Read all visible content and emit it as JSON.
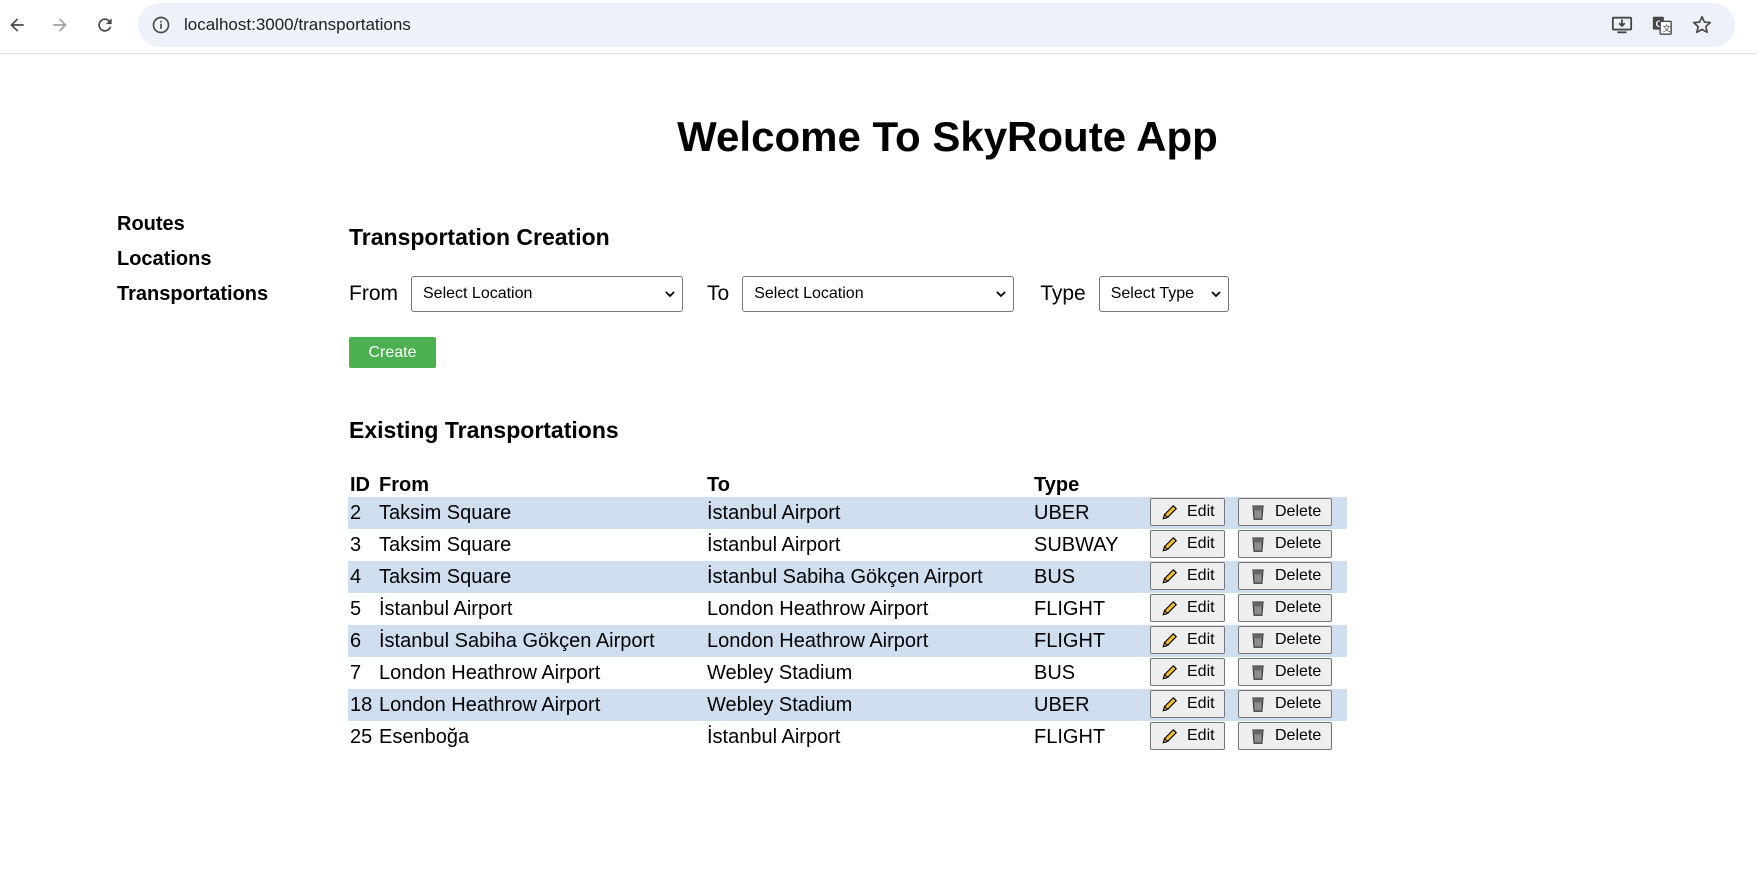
{
  "browser": {
    "url": "localhost:3000/transportations"
  },
  "page": {
    "title": "Welcome To SkyRoute App"
  },
  "sidebar": {
    "items": [
      {
        "label": "Routes"
      },
      {
        "label": "Locations"
      },
      {
        "label": "Transportations"
      }
    ]
  },
  "creation": {
    "title": "Transportation Creation",
    "from_label": "From",
    "from_value": "Select Location",
    "to_label": "To",
    "to_value": "Select Location",
    "type_label": "Type",
    "type_value": "Select Type",
    "create_label": "Create"
  },
  "existing": {
    "title": "Existing Transportations",
    "headers": {
      "id": "ID",
      "from": "From",
      "to": "To",
      "type": "Type"
    },
    "edit_label": "Edit",
    "delete_label": "Delete",
    "rows": [
      {
        "id": "2",
        "from": "Taksim Square",
        "to": "İstanbul Airport",
        "type": "UBER"
      },
      {
        "id": "3",
        "from": "Taksim Square",
        "to": "İstanbul Airport",
        "type": "SUBWAY"
      },
      {
        "id": "4",
        "from": "Taksim Square",
        "to": "İstanbul Sabiha Gökçen Airport",
        "type": "BUS"
      },
      {
        "id": "5",
        "from": "İstanbul Airport",
        "to": "London Heathrow Airport",
        "type": "FLIGHT"
      },
      {
        "id": "6",
        "from": "İstanbul Sabiha Gökçen Airport",
        "to": "London Heathrow Airport",
        "type": "FLIGHT"
      },
      {
        "id": "7",
        "from": "London Heathrow Airport",
        "to": "Webley Stadium",
        "type": "BUS"
      },
      {
        "id": "18",
        "from": "London Heathrow Airport",
        "to": "Webley Stadium",
        "type": "UBER"
      },
      {
        "id": "25",
        "from": "Esenboğa",
        "to": "İstanbul Airport",
        "type": "FLIGHT"
      }
    ]
  },
  "colors": {
    "create_button": "#4caf50",
    "row_stripe": "#cfdff0",
    "omnibox": "#edf2fa"
  }
}
